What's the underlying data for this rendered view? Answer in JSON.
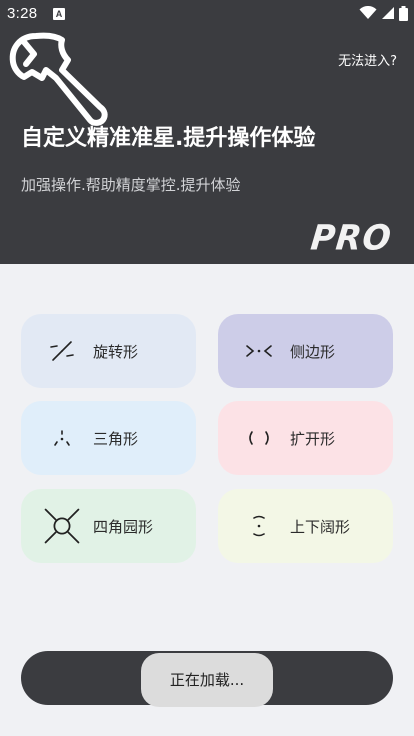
{
  "status_bar": {
    "time": "3:28",
    "notification_badge": "A",
    "icons": [
      "wifi-icon",
      "signal-icon",
      "battery-icon"
    ]
  },
  "header": {
    "help_link": "无法进入?",
    "title": "自定义精准准星.提升操作体验",
    "subtitle": "加强操作.帮助精度掌控.提升体验",
    "badge": "PRO",
    "icon": "wrench-icon"
  },
  "modes": [
    {
      "label": "旋转形",
      "icon": "rotate-crosshair-icon",
      "color": "#e2e9f4"
    },
    {
      "label": "侧边形",
      "icon": "side-crosshair-icon",
      "color": "#cdcde8"
    },
    {
      "label": "三角形",
      "icon": "triangle-crosshair-icon",
      "color": "#e0eefa"
    },
    {
      "label": "扩开形",
      "icon": "expand-crosshair-icon",
      "color": "#fce2e6"
    },
    {
      "label": "四角园形",
      "icon": "circle-crosshair-icon",
      "color": "#e1f2e6"
    },
    {
      "label": "上下阔形",
      "icon": "vertical-crosshair-icon",
      "color": "#f3f7e6"
    }
  ],
  "toast": {
    "text": "正在加载..."
  },
  "colors": {
    "header_bg": "#3b3c40",
    "page_bg": "#f0f1f4"
  }
}
